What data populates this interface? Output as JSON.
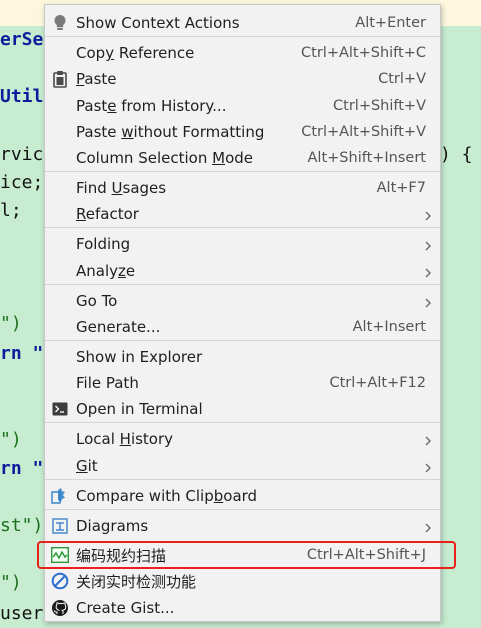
{
  "editor": {
    "lines": [
      {
        "text": "erSer",
        "cls": "kw purple"
      },
      {
        "text": "Util",
        "cls": "kw"
      },
      {
        "text": "rvic",
        "cls": ""
      },
      {
        "text": "ice;",
        "cls": ""
      },
      {
        "text": "l;",
        "cls": ""
      },
      {
        "text": "\")",
        "cls": "str"
      },
      {
        "text": "rn \"s",
        "cls": "kw"
      },
      {
        "text": "\")",
        "cls": "str"
      },
      {
        "text": "rn \"A",
        "cls": "kw"
      },
      {
        "text": "st\")",
        "cls": "str"
      },
      {
        "text": "\")",
        "cls": "str"
      },
      {
        "text": "user",
        "cls": ""
      }
    ],
    "right_text": ") {"
  },
  "menu": {
    "items": [
      {
        "label": "Show Context Actions",
        "shortcut": "Alt+Enter",
        "icon": "bulb-icon",
        "submenu": false
      },
      {
        "label": "Copy Reference",
        "mnemonic_index": 3,
        "shortcut": "Ctrl+Alt+Shift+C",
        "icon": "",
        "submenu": false
      },
      {
        "label": "Paste",
        "mnemonic_index": 0,
        "shortcut": "Ctrl+V",
        "icon": "clipboard-icon",
        "submenu": false
      },
      {
        "label": "Paste from History...",
        "mnemonic_index": 4,
        "shortcut": "Ctrl+Shift+V",
        "icon": "",
        "submenu": false
      },
      {
        "label": "Paste without Formatting",
        "mnemonic_index": 6,
        "shortcut": "Ctrl+Alt+Shift+V",
        "icon": "",
        "submenu": false
      },
      {
        "label": "Column Selection Mode",
        "mnemonic_index": 17,
        "shortcut": "Alt+Shift+Insert",
        "icon": "",
        "submenu": false
      },
      {
        "label": "Find Usages",
        "mnemonic_index": 5,
        "shortcut": "Alt+F7",
        "icon": "",
        "submenu": false
      },
      {
        "label": "Refactor",
        "mnemonic_index": 0,
        "shortcut": "",
        "icon": "",
        "submenu": true
      },
      {
        "label": "Folding",
        "shortcut": "",
        "icon": "",
        "submenu": true
      },
      {
        "label": "Analyze",
        "mnemonic_index": 5,
        "shortcut": "",
        "icon": "",
        "submenu": true
      },
      {
        "label": "Go To",
        "shortcut": "",
        "icon": "",
        "submenu": true
      },
      {
        "label": "Generate...",
        "shortcut": "Alt+Insert",
        "icon": "",
        "submenu": false
      },
      {
        "label": "Show in Explorer",
        "shortcut": "",
        "icon": "",
        "submenu": false
      },
      {
        "label": "File Path",
        "shortcut": "Ctrl+Alt+F12",
        "icon": "",
        "submenu": false
      },
      {
        "label": "Open in Terminal",
        "shortcut": "",
        "icon": "terminal-icon",
        "submenu": false
      },
      {
        "label": "Local History",
        "mnemonic_index": 6,
        "shortcut": "",
        "icon": "",
        "submenu": true
      },
      {
        "label": "Git",
        "mnemonic_index": 0,
        "shortcut": "",
        "icon": "",
        "submenu": true
      },
      {
        "label": "Compare with Clipboard",
        "mnemonic_index": 17,
        "shortcut": "",
        "icon": "compare-icon",
        "submenu": false
      },
      {
        "label": "Diagrams",
        "shortcut": "",
        "icon": "diagram-icon",
        "submenu": true
      },
      {
        "label": "编码规约扫描",
        "shortcut": "Ctrl+Alt+Shift+J",
        "icon": "scan-icon",
        "submenu": false
      },
      {
        "label": "关闭实时检测功能",
        "shortcut": "",
        "icon": "disable-icon",
        "submenu": false
      },
      {
        "label": "Create Gist...",
        "shortcut": "",
        "icon": "github-icon",
        "submenu": false
      }
    ]
  },
  "colors": {
    "editor_bg": "#c7ecd0",
    "menu_bg": "#f2f2f2",
    "highlight": "#e8221a"
  }
}
